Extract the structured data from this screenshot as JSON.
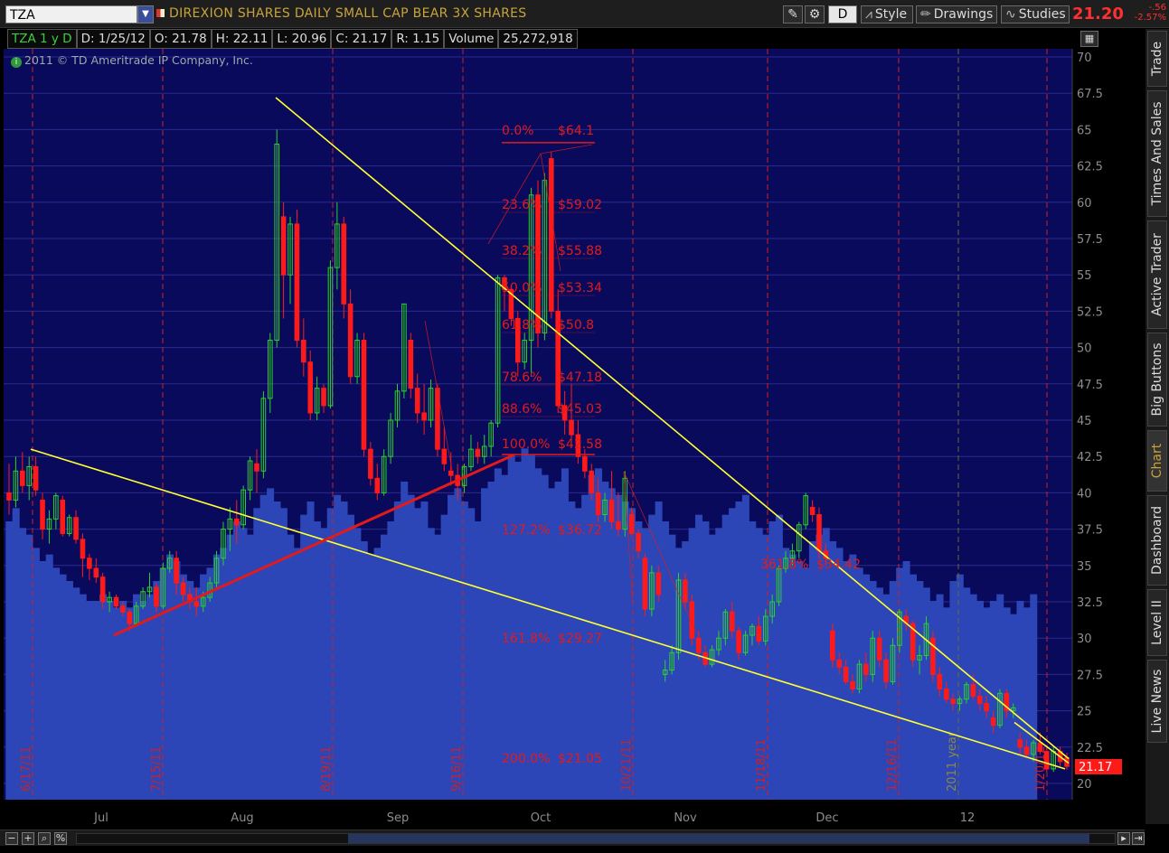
{
  "header": {
    "symbol": "TZA",
    "company": "DIREXION SHARES DAILY SMALL CAP BEAR 3X SHARES",
    "aggregation": "D",
    "style_label": "Style",
    "drawings_label": "Drawings",
    "studies_label": "Studies",
    "last_price": "21.20",
    "net_change": "-.56",
    "pct_change": "-2.57%"
  },
  "infobar": {
    "symbol_period": "TZA 1 y D",
    "date": "D: 1/25/12",
    "open": "O: 21.78",
    "high": "H: 22.11",
    "low": "L: 20.96",
    "close": "C: 21.17",
    "range": "R: 1.15",
    "volume_label": "Volume",
    "volume": "25,272,918"
  },
  "copyright": "2011 © TD Ameritrade IP Company, Inc.",
  "side_tabs": [
    "Trade",
    "Times And Sales",
    "Active Trader",
    "Big Buttons",
    "Chart",
    "Dashboard",
    "Level II",
    "Live News"
  ],
  "colors": {
    "background": "#0a0a5c",
    "volume": "#2c46b8",
    "up": "#2bd12b",
    "down": "#ff1a1a",
    "trendline": "#ffff33",
    "fib": "#e41a1a",
    "grid": "#2a2a8c",
    "axis_text": "#8c8c8c",
    "price_tag": "#ff1a1a"
  },
  "chart_data": {
    "type": "candlestick",
    "ylim": [
      19.5,
      71
    ],
    "y_ticks": [
      "70",
      "67.5",
      "65",
      "62.5",
      "60",
      "57.5",
      "55",
      "52.5",
      "50",
      "47.5",
      "45",
      "42.5",
      "40",
      "37.5",
      "35",
      "32.5",
      "30",
      "27.5",
      "25",
      "22.5",
      "20"
    ],
    "x_labels": [
      "Jul",
      "Aug",
      "Sep",
      "Oct",
      "Nov",
      "Dec",
      "12"
    ],
    "event_labels": [
      "6/17/11",
      "7/15/11",
      "8/19/11",
      "9/16/11",
      "10/21/11",
      "11/18/11",
      "12/16/11",
      "2011 year",
      "1/20/12"
    ],
    "last_close_tag": "21.17",
    "candles": [
      [
        40,
        42,
        38.5,
        39.5
      ],
      [
        39.5,
        42.5,
        39,
        41.5
      ],
      [
        41.5,
        42.8,
        40,
        40.5
      ],
      [
        40.5,
        42.5,
        39.5,
        41.8
      ],
      [
        41.8,
        42.5,
        39.8,
        40.2
      ],
      [
        39.5,
        40,
        36.8,
        37.5
      ],
      [
        37.5,
        38.8,
        36.5,
        38.2
      ],
      [
        38.2,
        40,
        37.5,
        39.8
      ],
      [
        39.5,
        39.8,
        37,
        37.2
      ],
      [
        37.2,
        38.5,
        37,
        38.3
      ],
      [
        38.3,
        38.8,
        36.5,
        36.8
      ],
      [
        36.8,
        37.2,
        34.2,
        35.5
      ],
      [
        35.5,
        35.8,
        34,
        34.8
      ],
      [
        34.8,
        35.5,
        33.8,
        34.2
      ],
      [
        34.2,
        34.5,
        32,
        32.5
      ],
      [
        32.5,
        33.2,
        31.8,
        32.8
      ],
      [
        32.8,
        33,
        32,
        32.2
      ],
      [
        32.2,
        32.5,
        31.5,
        31.8
      ],
      [
        31.8,
        32,
        30.5,
        31
      ],
      [
        31,
        32.5,
        30.8,
        32.2
      ],
      [
        32.2,
        33.5,
        32,
        33.2
      ],
      [
        33.2,
        34.5,
        32.8,
        33.5
      ],
      [
        33.5,
        33.8,
        31.8,
        32.2
      ],
      [
        32.2,
        35.2,
        32,
        34.8
      ],
      [
        34.8,
        36,
        34.5,
        35.5
      ],
      [
        35.5,
        36,
        33,
        33.8
      ],
      [
        33.8,
        34.2,
        32.5,
        33
      ],
      [
        33,
        33.5,
        32,
        32.5
      ],
      [
        32.5,
        33.5,
        31.5,
        32.2
      ],
      [
        32.2,
        33.2,
        31.8,
        32.8
      ],
      [
        32.8,
        34.2,
        32.5,
        33.8
      ],
      [
        33.8,
        36,
        33.5,
        35.5
      ],
      [
        35.5,
        38,
        35,
        37.5
      ],
      [
        37.5,
        39,
        36,
        38.2
      ],
      [
        38.2,
        39.5,
        36.5,
        37.8
      ],
      [
        37.8,
        40.5,
        37.5,
        40.2
      ],
      [
        40.2,
        42.5,
        39.5,
        42.2
      ],
      [
        42,
        43,
        40,
        41.5
      ],
      [
        41.5,
        47,
        41,
        46.5
      ],
      [
        46.5,
        51,
        45.5,
        50.5
      ],
      [
        50.5,
        65,
        50,
        64
      ],
      [
        59,
        60,
        52,
        55
      ],
      [
        55,
        59,
        53,
        58.5
      ],
      [
        58.5,
        59.5,
        50,
        50.5
      ],
      [
        50.5,
        52,
        48,
        49
      ],
      [
        49,
        49.8,
        45,
        45.5
      ],
      [
        45.5,
        48,
        45,
        47.2
      ],
      [
        47.2,
        47.5,
        45.5,
        46
      ],
      [
        46,
        56,
        45.8,
        55.5
      ],
      [
        55.5,
        60,
        54,
        58.5
      ],
      [
        58.5,
        59,
        52,
        53
      ],
      [
        53,
        54,
        47.5,
        48
      ],
      [
        48,
        51,
        47.5,
        50.5
      ],
      [
        50.5,
        51,
        42.5,
        43
      ],
      [
        43,
        43.5,
        40.5,
        41
      ],
      [
        41,
        42,
        39.5,
        40
      ],
      [
        40,
        43,
        39.8,
        42.5
      ],
      [
        42.5,
        45.5,
        42,
        45
      ],
      [
        45,
        47.5,
        44.5,
        47
      ],
      [
        47,
        53,
        46.5,
        53
      ],
      [
        50.5,
        51,
        46.5,
        47.2
      ],
      [
        47.2,
        48.2,
        44.8,
        45.5
      ],
      [
        45.5,
        47.5,
        44,
        45
      ],
      [
        45,
        47.8,
        44.5,
        47.2
      ],
      [
        47.2,
        47.5,
        42.5,
        43
      ],
      [
        43,
        44.5,
        41.5,
        42
      ],
      [
        41.5,
        42.8,
        40.5,
        41.2
      ],
      [
        41.2,
        42,
        39.5,
        40.5
      ],
      [
        40.5,
        42,
        40,
        41.8
      ],
      [
        41.8,
        44,
        41.5,
        43
      ],
      [
        43,
        43.5,
        42,
        42.5
      ],
      [
        42.5,
        44,
        42,
        43.2
      ],
      [
        43.2,
        45,
        42.5,
        44.8
      ],
      [
        44.8,
        55,
        44.5,
        54.8
      ],
      [
        54.8,
        55,
        52.5,
        54
      ],
      [
        54,
        54.2,
        51.5,
        52
      ],
      [
        52,
        52.5,
        48,
        49
      ],
      [
        49,
        51,
        48.5,
        50.5
      ],
      [
        50.5,
        61,
        48,
        60.5
      ],
      [
        60.5,
        61.5,
        50,
        51
      ],
      [
        51,
        62,
        50.5,
        61.5
      ],
      [
        63,
        63.5,
        52,
        52.5
      ],
      [
        52.5,
        54,
        45.5,
        46
      ],
      [
        46,
        47,
        44,
        45
      ],
      [
        45,
        47.5,
        43.5,
        44
      ],
      [
        44,
        45,
        42,
        42.5
      ],
      [
        42.5,
        43,
        41,
        41.5
      ],
      [
        41.5,
        42,
        39.5,
        40
      ],
      [
        40,
        41,
        38,
        38.5
      ],
      [
        38.5,
        40,
        38,
        39.5
      ],
      [
        39.5,
        41.5,
        37.5,
        38
      ],
      [
        38,
        40,
        37,
        37.5
      ],
      [
        37.5,
        41.5,
        37,
        41
      ],
      [
        38.5,
        39,
        37,
        37.2
      ],
      [
        37.2,
        37.5,
        35.5,
        36
      ],
      [
        35.5,
        35.8,
        31.5,
        32
      ],
      [
        32,
        35,
        31.5,
        34.5
      ],
      [
        34.5,
        35,
        32.5,
        33
      ],
      [
        27.5,
        28.5,
        27,
        27.8
      ],
      [
        27.8,
        29.5,
        27.5,
        29
      ],
      [
        29,
        34.5,
        28.5,
        34
      ],
      [
        34,
        34.5,
        32,
        32.5
      ],
      [
        32.5,
        33,
        29.5,
        30
      ],
      [
        30,
        30.5,
        28.5,
        29
      ],
      [
        29,
        29.5,
        28,
        28.2
      ],
      [
        28.2,
        29.5,
        28,
        29.2
      ],
      [
        29.2,
        30.5,
        28.8,
        30
      ],
      [
        30,
        32,
        29.5,
        31.8
      ],
      [
        31.8,
        32.5,
        30,
        30.5
      ],
      [
        30.5,
        30.8,
        28.5,
        29
      ],
      [
        29,
        30.5,
        28.8,
        30.2
      ],
      [
        30.2,
        31,
        29.5,
        30.8
      ],
      [
        30.8,
        31.5,
        29.5,
        29.8
      ],
      [
        29.8,
        32,
        29.5,
        31.5
      ],
      [
        31.5,
        33,
        31,
        32.5
      ],
      [
        32.5,
        35,
        32.2,
        34.8
      ],
      [
        34.8,
        36,
        34.5,
        35.5
      ],
      [
        35.5,
        36.5,
        35,
        36
      ],
      [
        36,
        38,
        35.5,
        37.8
      ],
      [
        37.8,
        40,
        37.5,
        39.8
      ],
      [
        39,
        39.5,
        38,
        38.5
      ],
      [
        38.5,
        39,
        35.5,
        36
      ],
      [
        36,
        36.5,
        35,
        35.5
      ],
      [
        30.5,
        31,
        28,
        28.5
      ],
      [
        28.5,
        29,
        27.5,
        28
      ],
      [
        28,
        28.5,
        26.8,
        27
      ],
      [
        27,
        27.5,
        26.2,
        26.5
      ],
      [
        26.5,
        28.5,
        26.2,
        28.2
      ],
      [
        28.2,
        29,
        27,
        27.5
      ],
      [
        27.5,
        30.5,
        27,
        30
      ],
      [
        30,
        30.5,
        28,
        28.5
      ],
      [
        28.5,
        29,
        26.5,
        27
      ],
      [
        27,
        30,
        26.8,
        29.5
      ],
      [
        29.5,
        32,
        29,
        31.8
      ],
      [
        31.5,
        32,
        30.5,
        31
      ],
      [
        31,
        31.2,
        28,
        28.5
      ],
      [
        28.5,
        29.5,
        27.5,
        28.8
      ],
      [
        28.8,
        31.5,
        28.5,
        31
      ],
      [
        30,
        30.5,
        27,
        27.5
      ],
      [
        27.5,
        28,
        26,
        26.5
      ],
      [
        26.5,
        27,
        25.5,
        25.8
      ],
      [
        25.8,
        26.2,
        25,
        25.5
      ],
      [
        25.5,
        26,
        25,
        25.8
      ],
      [
        25.8,
        27,
        25.5,
        26.8
      ],
      [
        26.8,
        27.5,
        25.8,
        26
      ],
      [
        26,
        26.5,
        25,
        25.5
      ],
      [
        25.5,
        26,
        24.5,
        25
      ],
      [
        24.5,
        25,
        23.5,
        24
      ],
      [
        24,
        26.5,
        23.8,
        26.2
      ],
      [
        26.2,
        26.5,
        24.5,
        25
      ],
      [
        25,
        25.5,
        24.5,
        25.2
      ],
      [
        23,
        23.5,
        22,
        22.5
      ],
      [
        22.5,
        23,
        21.8,
        22
      ],
      [
        22,
        23,
        21.5,
        22.8
      ],
      [
        22.8,
        23.5,
        22,
        22.2
      ],
      [
        22.2,
        22.5,
        20.8,
        21
      ],
      [
        21,
        22.5,
        20.8,
        22.2
      ],
      [
        22.2,
        22.5,
        21.2,
        21.5
      ],
      [
        21.78,
        22.11,
        20.96,
        21.17
      ]
    ],
    "volume_levels": [
      42,
      44,
      41,
      40,
      38,
      36,
      37,
      35,
      34,
      33,
      32,
      31,
      30,
      30,
      31,
      30,
      29,
      30,
      29,
      31,
      30,
      31,
      33,
      35,
      37,
      36,
      34,
      33,
      32,
      34,
      35,
      37,
      38,
      40,
      42,
      41,
      40,
      44,
      46,
      47,
      45,
      44,
      40,
      38,
      43,
      45,
      42,
      41,
      44,
      46,
      45,
      43,
      41,
      39,
      37,
      38,
      40,
      42,
      45,
      48,
      46,
      44,
      45,
      41,
      40,
      43,
      46,
      47,
      45,
      44,
      42,
      47,
      48,
      50,
      49,
      52,
      51,
      53,
      52,
      50,
      49,
      47,
      48,
      50,
      45,
      44,
      46,
      49,
      50,
      48,
      47,
      46,
      45,
      44,
      42,
      41,
      43,
      45,
      42,
      40,
      38,
      39,
      41,
      43,
      42,
      40,
      41,
      43,
      44,
      45,
      46,
      42,
      41,
      40,
      42,
      43,
      38,
      37,
      36,
      35,
      39,
      40,
      41,
      39,
      38,
      36,
      37,
      35,
      34,
      33,
      32,
      31,
      33,
      35,
      36,
      34,
      33,
      32,
      30,
      31,
      29,
      33,
      34,
      32,
      31,
      30,
      29,
      30,
      31,
      29,
      28,
      30,
      29,
      31
    ],
    "fibonacci": [
      {
        "level": "0.0%",
        "price": "$64.1"
      },
      {
        "level": "23.6%",
        "price": "$59.02"
      },
      {
        "level": "38.2%",
        "price": "$55.88"
      },
      {
        "level": "50.0%",
        "price": "$53.34"
      },
      {
        "level": "61.8%",
        "price": "$50.8"
      },
      {
        "level": "78.6%",
        "price": "$47.18"
      },
      {
        "level": "88.6%",
        "price": "$45.03"
      },
      {
        "level": "100.0%",
        "price": "$42.58"
      },
      {
        "level": "127.2%",
        "price": "$36.72"
      },
      {
        "level": "161.8%",
        "price": "$29.27"
      },
      {
        "level": "200.0%",
        "price": "$21.05"
      },
      {
        "level": "361.8%",
        "price": "$34.42"
      }
    ]
  }
}
